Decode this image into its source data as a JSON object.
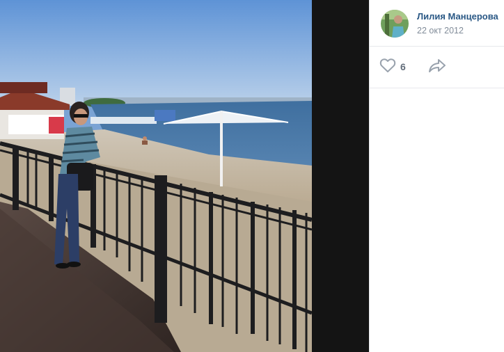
{
  "post": {
    "author": "Лилия Манцерова",
    "date": "22 окт 2012"
  },
  "actions": {
    "likes_count": "6",
    "like_icon": "heart-outline-icon",
    "share_icon": "share-arrow-icon"
  },
  "colors": {
    "author_link": "#2a5885",
    "date_text": "#818c99",
    "icon_gray": "#99a2ad",
    "viewer_background": "#141414"
  }
}
